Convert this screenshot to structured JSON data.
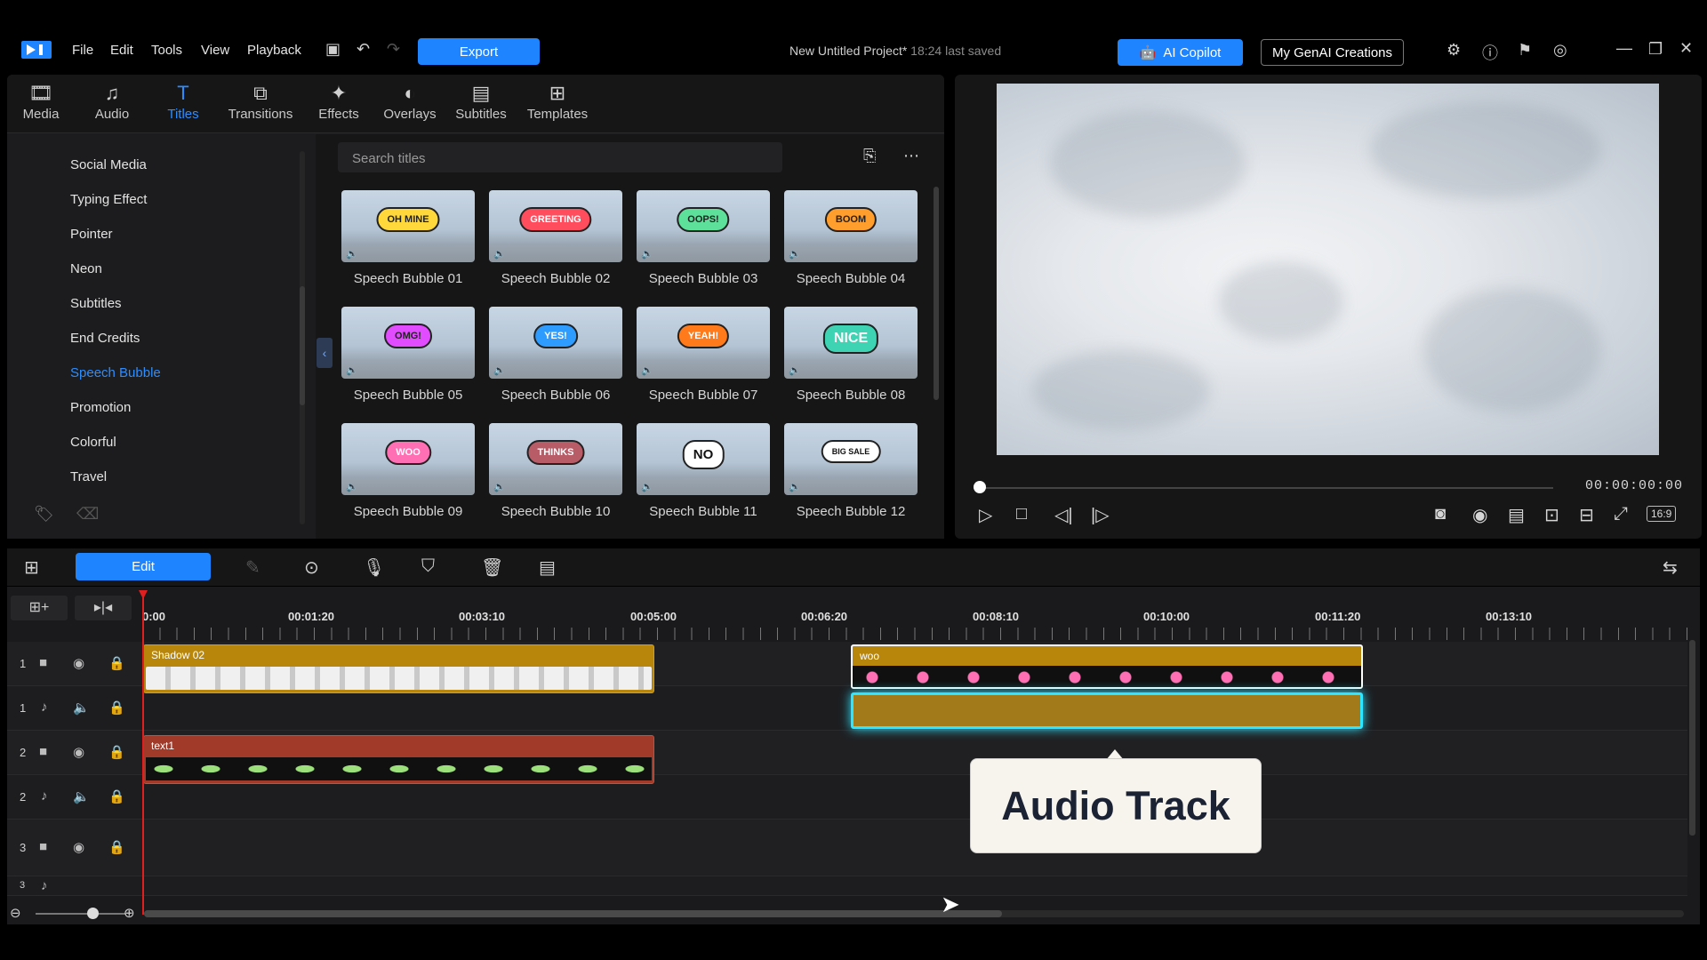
{
  "menu": [
    "File",
    "Edit",
    "Tools",
    "View",
    "Playback"
  ],
  "export_label": "Export",
  "project": {
    "title": "New Untitled Project*",
    "saved": "18:24 last saved"
  },
  "ai_copilot": "AI Copilot",
  "my_genai": "My GenAI Creations",
  "lib_tabs": [
    "Media",
    "Audio",
    "Titles",
    "Transitions",
    "Effects",
    "Overlays",
    "Subtitles",
    "Templates"
  ],
  "categories": [
    "Social Media",
    "Typing Effect",
    "Pointer",
    "Neon",
    "Subtitles",
    "End Credits",
    "Speech Bubble",
    "Promotion",
    "Colorful",
    "Travel"
  ],
  "active_category": "Speech Bubble",
  "search_placeholder": "Search titles",
  "titles": [
    {
      "label": "Speech Bubble 01",
      "badge": "OH MINE"
    },
    {
      "label": "Speech Bubble 02",
      "badge": "GREETING"
    },
    {
      "label": "Speech Bubble 03",
      "badge": "OOPS!"
    },
    {
      "label": "Speech Bubble 04",
      "badge": "BOOM"
    },
    {
      "label": "Speech Bubble 05",
      "badge": "OMG!"
    },
    {
      "label": "Speech Bubble 06",
      "badge": "YES!"
    },
    {
      "label": "Speech Bubble 07",
      "badge": "YEAH!"
    },
    {
      "label": "Speech Bubble 08",
      "badge": "NICE"
    },
    {
      "label": "Speech Bubble 09",
      "badge": "WOO"
    },
    {
      "label": "Speech Bubble 10",
      "badge": "THINKS"
    },
    {
      "label": "Speech Bubble 11",
      "badge": "NO"
    },
    {
      "label": "Speech Bubble 12",
      "badge": "BIG SALE"
    }
  ],
  "timecode": "00:00:00:00",
  "aspect": "16:9",
  "edit_label": "Edit",
  "ruler": [
    "0:00",
    "00:01:20",
    "00:03:10",
    "00:05:00",
    "00:06:20",
    "00:08:10",
    "00:10:00",
    "00:11:20",
    "00:13:10"
  ],
  "tracks": [
    "1",
    "1",
    "2",
    "2",
    "3",
    "3"
  ],
  "clips": {
    "shadow": "Shadow 02",
    "woo": "woo",
    "text1": "text1"
  },
  "tooltip": "Audio Track",
  "colors": {
    "accent": "#1e84ff",
    "clip_gold": "#b8860b",
    "clip_red": "#a23a2a",
    "highlight": "#2ee6ff"
  }
}
